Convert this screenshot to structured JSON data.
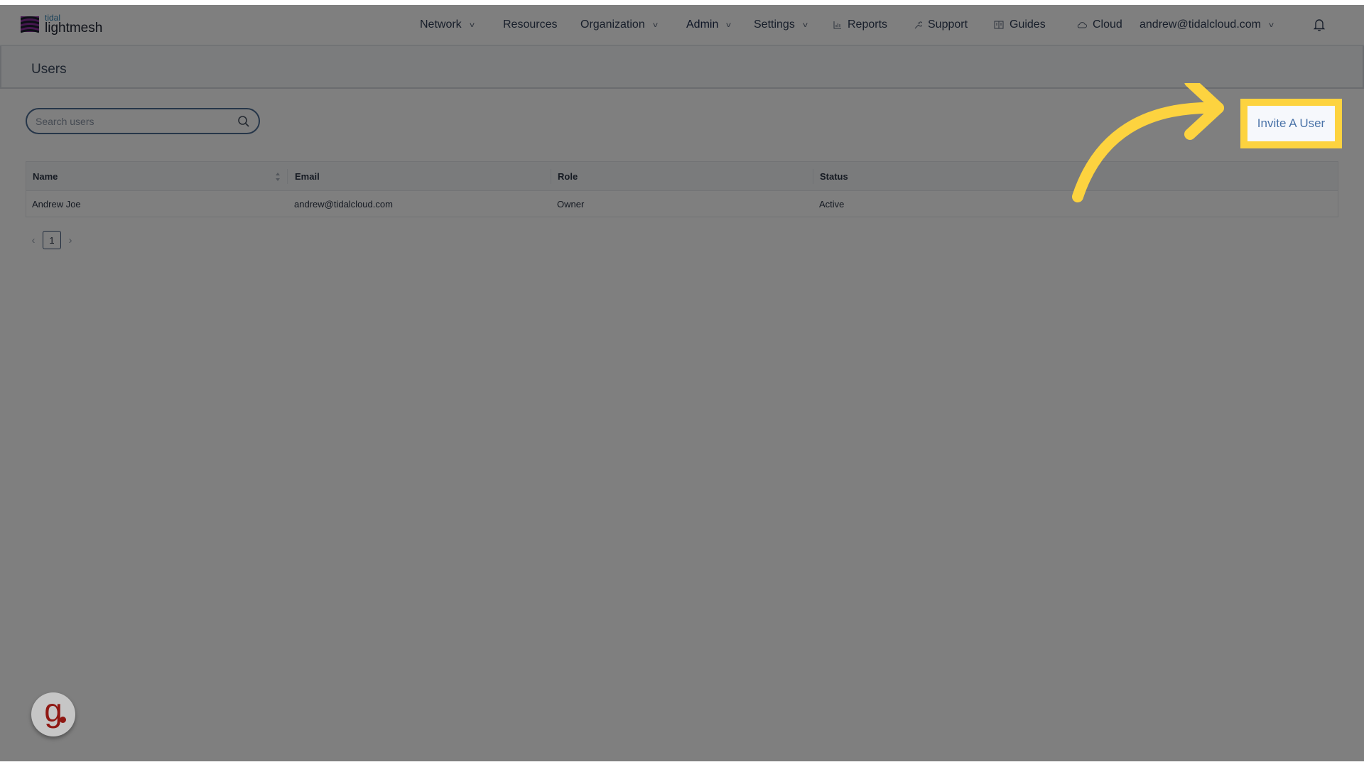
{
  "brand": {
    "small": "tidal",
    "big": "lightmesh"
  },
  "nav": {
    "items": [
      {
        "label": "Network",
        "dropdown": true,
        "icon": null
      },
      {
        "label": "Resources",
        "dropdown": false,
        "icon": null
      },
      {
        "label": "Organization",
        "dropdown": true,
        "icon": null
      },
      {
        "label": "Admin",
        "dropdown": true,
        "icon": null,
        "active": true
      },
      {
        "label": "Settings",
        "dropdown": true,
        "icon": null
      },
      {
        "label": "Reports",
        "dropdown": false,
        "icon": "bar-chart-icon"
      },
      {
        "label": "Support",
        "dropdown": false,
        "icon": "wrench-icon"
      },
      {
        "label": "Guides",
        "dropdown": false,
        "icon": "book-icon"
      },
      {
        "label": "Cloud",
        "dropdown": false,
        "icon": "cloud-icon"
      }
    ],
    "user_email": "andrew@tidalcloud.com",
    "notifications_icon": "bell-icon"
  },
  "page": {
    "title": "Users"
  },
  "search": {
    "placeholder": "Search users",
    "value": ""
  },
  "actions": {
    "invite_label": "Invite A User"
  },
  "table": {
    "columns": [
      "Name",
      "Email",
      "Role",
      "Status"
    ],
    "rows": [
      {
        "name": "Andrew Joe",
        "email": "andrew@tidalcloud.com",
        "role": "Owner",
        "status": "Active"
      }
    ]
  },
  "pagination": {
    "current": "1",
    "prev_icon": "chevron-left-icon",
    "next_icon": "chevron-right-icon"
  },
  "colors": {
    "highlight": "#fdd33f",
    "accent": "#4a73a8",
    "overlay": "rgba(0,0,0,0.5)",
    "guide_brand": "#8f1813"
  },
  "guide_badge": {
    "letter": "g"
  }
}
